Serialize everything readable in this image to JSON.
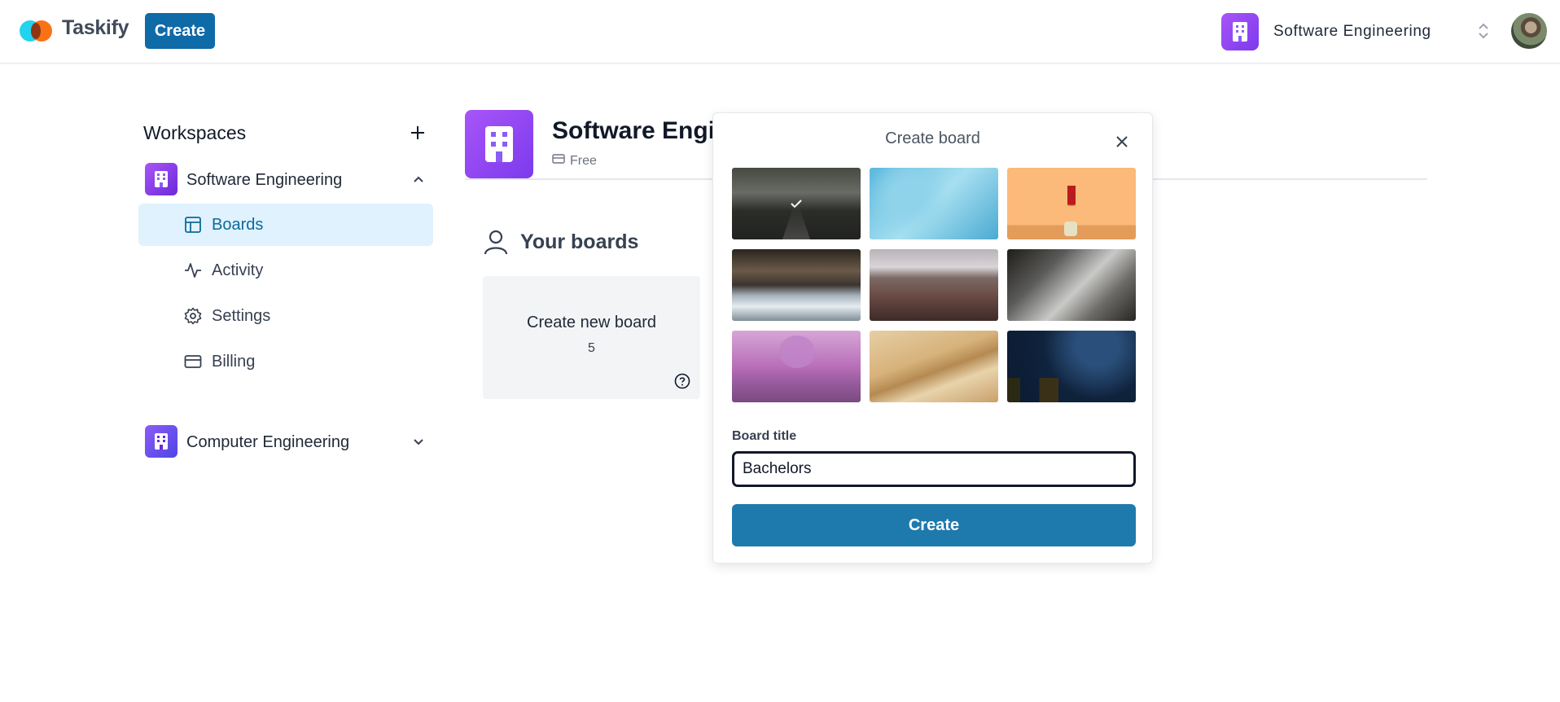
{
  "navbar": {
    "logo_text": "Taskify",
    "create_label": "Create",
    "org_name": "Software Engineering"
  },
  "sidebar": {
    "title": "Workspaces",
    "workspaces": [
      {
        "name": "Software Engineering",
        "expanded": true,
        "items": [
          {
            "label": "Boards",
            "icon": "board-icon",
            "active": true
          },
          {
            "label": "Activity",
            "icon": "activity-icon",
            "active": false
          },
          {
            "label": "Settings",
            "icon": "settings-icon",
            "active": false
          },
          {
            "label": "Billing",
            "icon": "credit-card-icon",
            "active": false
          }
        ]
      },
      {
        "name": "Computer Engineering",
        "expanded": false
      }
    ]
  },
  "main": {
    "workspace_title": "Software Engineering",
    "plan": "Free",
    "boards_heading": "Your boards",
    "new_board_label": "Create new board",
    "remaining_count": "5"
  },
  "popover": {
    "title": "Create board",
    "images": [
      {
        "name": "foggy-forest-road",
        "selected": true
      },
      {
        "name": "blue-texture",
        "selected": false
      },
      {
        "name": "flowers-vase",
        "selected": false
      },
      {
        "name": "waves-shore",
        "selected": false
      },
      {
        "name": "mountain-range",
        "selected": false
      },
      {
        "name": "snowy-forest",
        "selected": false
      },
      {
        "name": "pink-tree",
        "selected": false
      },
      {
        "name": "desert-dunes",
        "selected": false
      },
      {
        "name": "star-trails",
        "selected": false
      }
    ],
    "field_label": "Board title",
    "input_value": "Bachelors",
    "submit_label": "Create"
  },
  "colors": {
    "primary": "#1e79ad",
    "workspace_icon": "#a855f7",
    "active_bg": "#e0f2fe"
  }
}
